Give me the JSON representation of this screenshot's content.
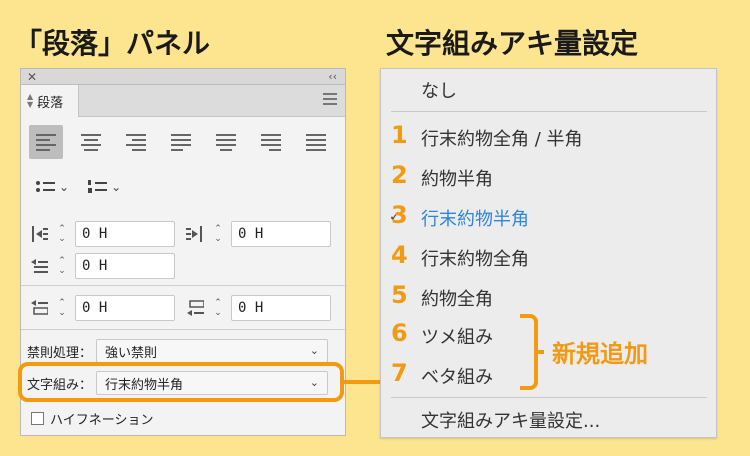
{
  "headings": {
    "left": "「段落」パネル",
    "right": "文字組みアキ量設定"
  },
  "panel": {
    "close_glyph": "✕",
    "collapse_glyph": "‹‹",
    "tab_label": "段落",
    "alignment_buttons": [
      "align-left",
      "align-center",
      "align-right",
      "justify-left",
      "justify-center",
      "justify-right",
      "justify-all"
    ],
    "active_alignment": "align-left",
    "fields": {
      "left_indent": "0 H",
      "right_indent": "0 H",
      "first_line_indent": "0 H",
      "space_before": "0 H",
      "space_after": "0 H"
    },
    "kinsoku": {
      "label": "禁則処理：",
      "value": "強い禁則"
    },
    "mojikumi": {
      "label": "文字組み：",
      "value": "行末約物半角"
    },
    "hyphenation": {
      "label": "ハイフネーション",
      "checked": false
    }
  },
  "menu": {
    "none": "なし",
    "items": [
      {
        "num": "1",
        "label": "行末約物全角 / 半角"
      },
      {
        "num": "2",
        "label": "約物半角"
      },
      {
        "num": "3",
        "label": "行末約物半角",
        "selected": true
      },
      {
        "num": "4",
        "label": "行末約物全角"
      },
      {
        "num": "5",
        "label": "約物全角"
      },
      {
        "num": "6",
        "label": "ツメ組み"
      },
      {
        "num": "7",
        "label": "ベタ組み"
      }
    ],
    "settings": "文字組みアキ量設定...",
    "new_label": "新規追加",
    "check_glyph": "✓"
  },
  "colors": {
    "background": "#fde58f",
    "accent": "#f29a11",
    "selected": "#2f86d9"
  }
}
